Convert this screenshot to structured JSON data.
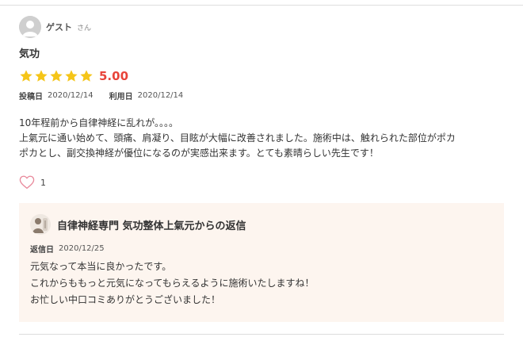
{
  "review": {
    "user": {
      "name": "ゲスト",
      "honorific": "さん",
      "avatar_icon": "user-silhouette-icon"
    },
    "title": "気功",
    "rating": {
      "stars": 5,
      "max_stars": 5,
      "score": "5.00",
      "star_color": "#f5c518",
      "score_color": "#e8443a"
    },
    "posted": {
      "label": "投稿日",
      "value": "2020/12/14"
    },
    "used": {
      "label": "利用日",
      "value": "2020/12/14"
    },
    "body_lines": [
      "10年程前から自律神経に乱れが。。。。",
      "上氣元に通い始めて、頭痛、肩凝り、目眩が大幅に改善されました。施術中は、触れられた部位がポカ",
      "ポカとし、副交換神経が優位になるのが実感出来ます。とても素晴らしい先生です！"
    ],
    "likes": {
      "icon": "heart-outline-icon",
      "count": "1",
      "color": "#e8889a"
    }
  },
  "reply": {
    "avatar_icon": "clinic-avatar-icon",
    "title": "自律神経専門 気功整体上氣元からの返信",
    "date": {
      "label": "返信日",
      "value": "2020/12/25"
    },
    "body_lines": [
      "元気なって本当に良かったです。",
      "これからももっと元気になってもらえるように施術いたしますね！",
      "お忙しい中口コミありがとうございました！"
    ],
    "background": "#fdf5ef"
  }
}
